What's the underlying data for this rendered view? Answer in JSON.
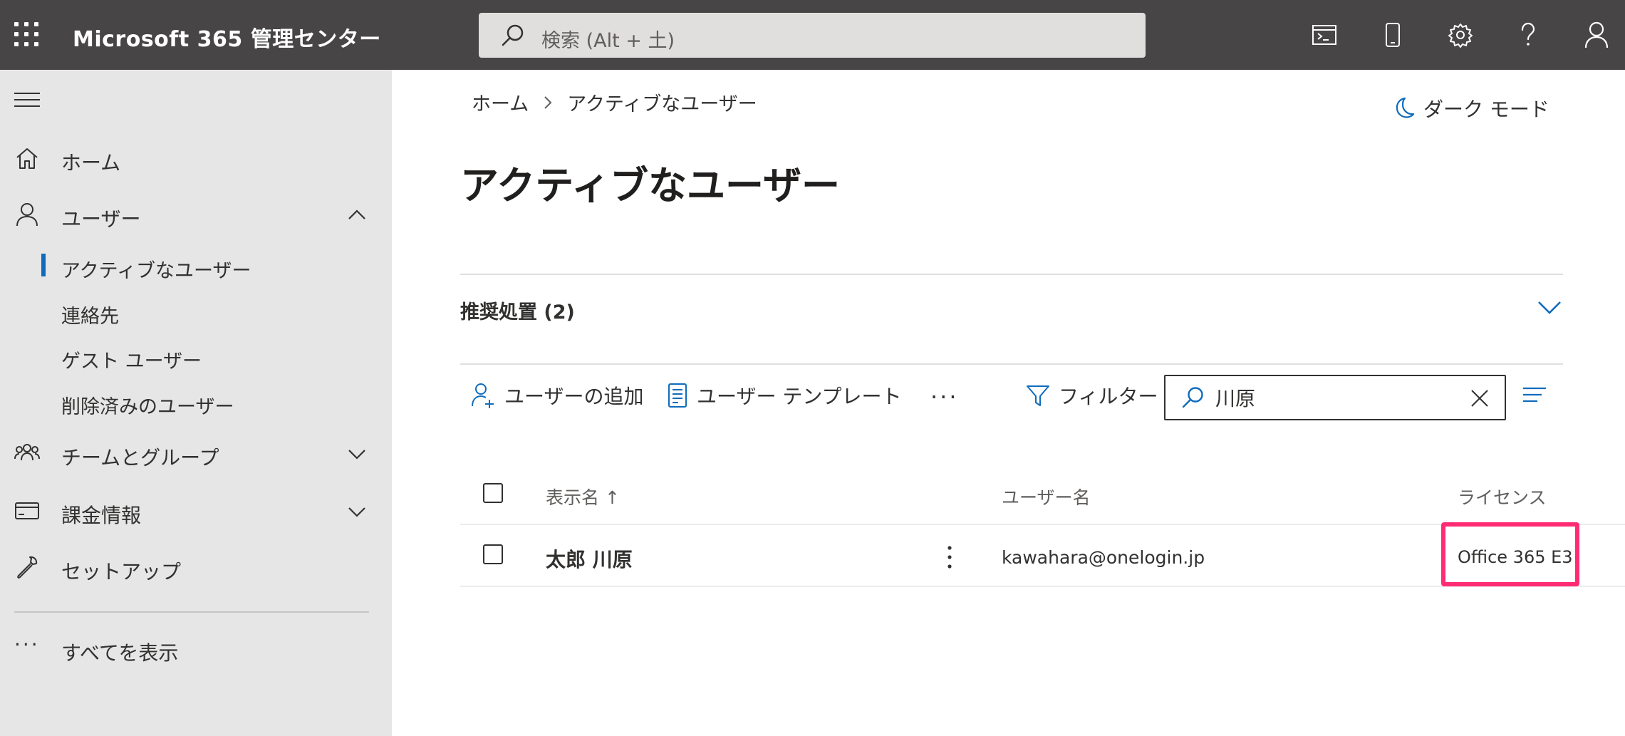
{
  "app": {
    "title": "Microsoft 365 管理センター",
    "search_placeholder": "検索 (Alt + 土)"
  },
  "topbar_icons": [
    "terminal-icon",
    "mobile-icon",
    "gear-icon",
    "help-icon",
    "user-account-icon"
  ],
  "sidebar": {
    "items": [
      {
        "label": "ホーム",
        "icon": "home-icon"
      },
      {
        "label": "ユーザー",
        "icon": "person-icon",
        "expanded": true,
        "children": [
          {
            "label": "アクティブなユーザー",
            "active": true
          },
          {
            "label": "連絡先"
          },
          {
            "label": "ゲスト ユーザー"
          },
          {
            "label": "削除済みのユーザー"
          }
        ]
      },
      {
        "label": "チームとグループ",
        "icon": "group-icon",
        "expanded": false
      },
      {
        "label": "課金情報",
        "icon": "credit-card-icon",
        "expanded": false
      },
      {
        "label": "セットアップ",
        "icon": "wrench-icon"
      }
    ],
    "show_all": "すべてを表示"
  },
  "breadcrumb": [
    "ホーム",
    "アクティブなユーザー"
  ],
  "dark_mode_label": "ダーク モード",
  "page_title": "アクティブなユーザー",
  "recommended": {
    "label": "推奨処置 (2)"
  },
  "commands": {
    "add_user": "ユーザーの追加",
    "user_template": "ユーザー テンプレート",
    "more": "···",
    "filter": "フィルター"
  },
  "filter_search": {
    "value": "川原"
  },
  "table": {
    "columns": {
      "display_name": "表示名 ↑",
      "username": "ユーザー名",
      "license": "ライセンス"
    },
    "rows": [
      {
        "display_name": "太郎 川原",
        "username": "kawahara@onelogin.jp",
        "license": "Office 365 E3"
      }
    ]
  },
  "colors": {
    "topbar": "#474545",
    "sidebar": "#e6e6e6",
    "accent": "#0f6cbd",
    "highlight": "#ff2c74"
  }
}
